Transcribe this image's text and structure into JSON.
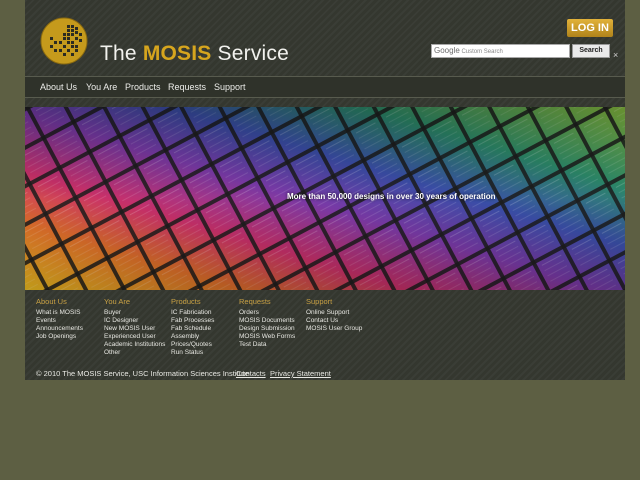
{
  "header": {
    "title_prefix": "The ",
    "title_accent": "MOSIS",
    "title_suffix": " Service",
    "login_label": "LOG IN",
    "search": {
      "brand": "Google",
      "placeholder": "Custom Search",
      "button_label": "Search",
      "close_label": "×"
    }
  },
  "nav": {
    "items": [
      "About Us",
      "You Are",
      "Products",
      "Requests",
      "Support"
    ]
  },
  "hero": {
    "caption": "More than 50,000 designs in over 30 years of operation"
  },
  "footer": {
    "columns": [
      {
        "heading": "About Us",
        "links": [
          "What is MOSIS",
          "Events",
          "Announcements",
          "Job Openings"
        ]
      },
      {
        "heading": "You Are",
        "links": [
          "Buyer",
          "IC Designer",
          "New MOSIS User",
          "Experienced User",
          "Academic Institutions",
          "Other"
        ]
      },
      {
        "heading": "Products",
        "links": [
          "IC Fabrication",
          "Fab Processes",
          "Fab Schedule",
          "Assembly",
          "Prices/Quotes",
          "Run Status"
        ]
      },
      {
        "heading": "Requests",
        "links": [
          "Orders",
          "MOSIS Documents",
          "Design Submission",
          "MOSIS Web Forms",
          "Test Data"
        ]
      },
      {
        "heading": "Support",
        "links": [
          "Online Support",
          "Contact Us",
          "MOSIS User Group"
        ]
      }
    ],
    "copyright": "© 2010 The MOSIS Service, USC Information Sciences Institute",
    "contacts_label": "Contacts",
    "privacy_label": "Privacy Statement"
  },
  "colors": {
    "background": "#5d5f43",
    "page": "#34372f",
    "accent_gold": "#d6a51e"
  },
  "icons": {
    "logo": "chip-logo",
    "close": "close-icon"
  }
}
